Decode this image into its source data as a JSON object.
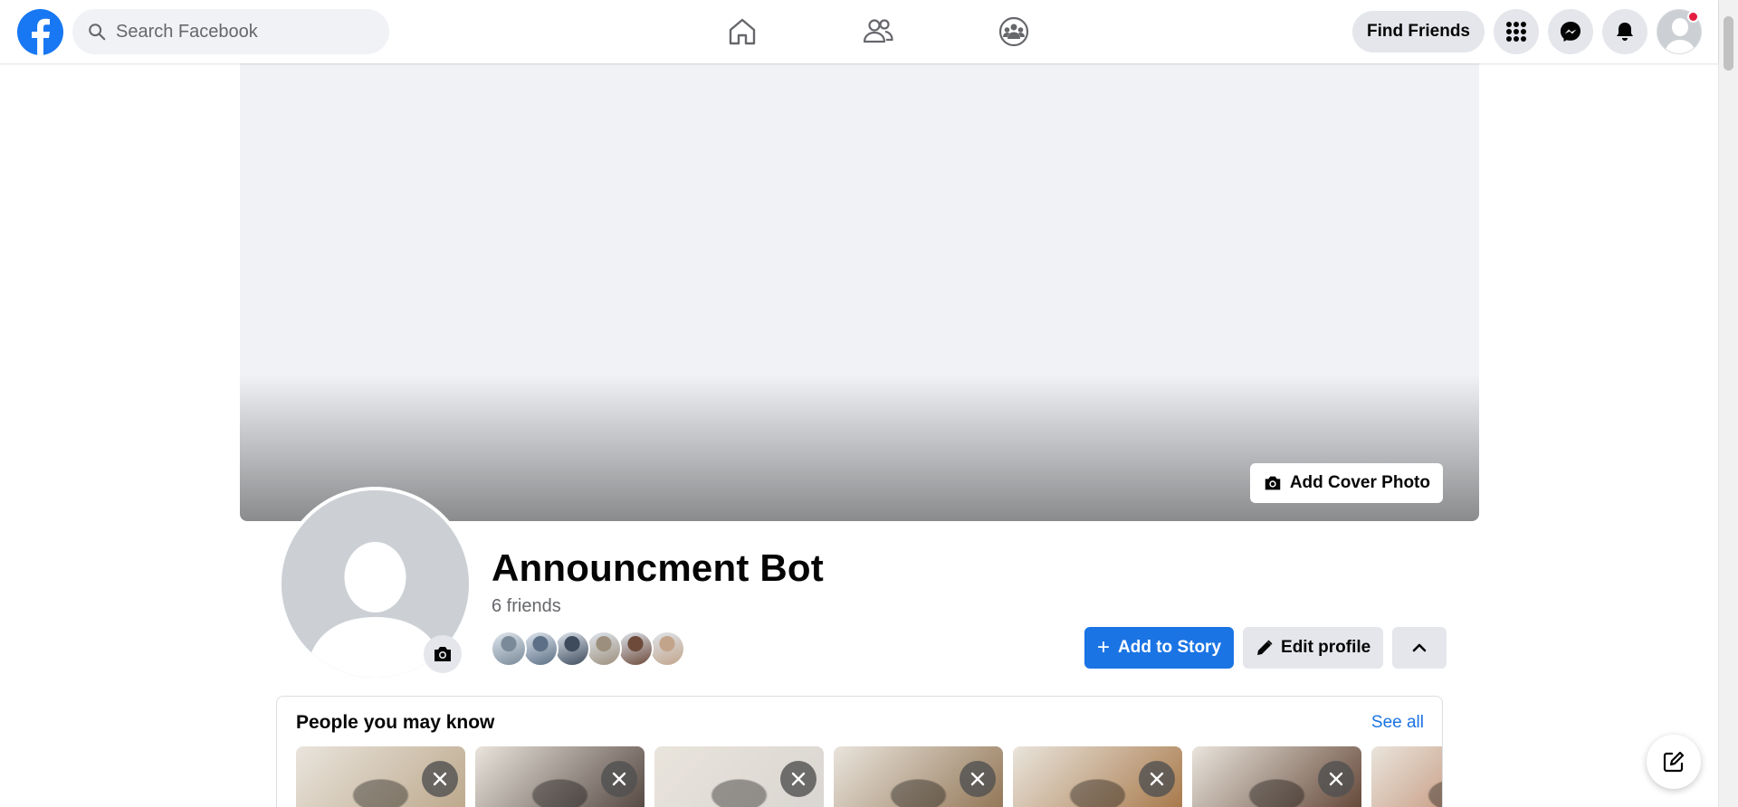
{
  "topbar": {
    "search_placeholder": "Search Facebook",
    "find_friends_label": "Find Friends",
    "nav_tabs": [
      "home-icon",
      "friends-icon",
      "groups-icon"
    ],
    "right_icons": [
      "menu-grid-icon",
      "messenger-icon",
      "notifications-icon"
    ],
    "brand_color": "#1877f2",
    "notification_dot_color": "#e41e3f"
  },
  "cover": {
    "add_cover_label": "Add Cover Photo"
  },
  "profile": {
    "name": "Announcment Bot",
    "friends_text": "6 friends",
    "friend_avatar_colors": [
      "#7a8a99",
      "#5c6f86",
      "#3d4b5c",
      "#9d8f7d",
      "#6d4a3a",
      "#c2a48a"
    ],
    "add_story_label": "Add to Story",
    "edit_profile_label": "Edit profile",
    "accent_color": "#1b74e4"
  },
  "pymk": {
    "title": "People you may know",
    "see_all_label": "See all",
    "cards": [
      {
        "tone": "#b9a486"
      },
      {
        "tone": "#4a3c36"
      },
      {
        "tone": "#d8d4cf"
      },
      {
        "tone": "#8c6e4c"
      },
      {
        "tone": "#a3713f"
      },
      {
        "tone": "#5a3c2c"
      },
      {
        "tone": "#b06a44"
      }
    ]
  }
}
